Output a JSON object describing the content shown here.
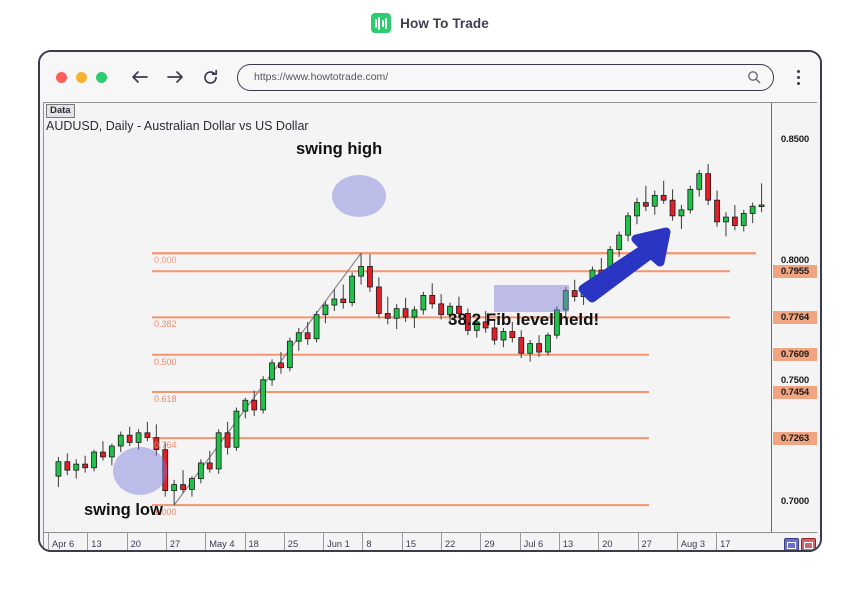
{
  "brand": {
    "title": "How To Trade",
    "icon": "bar-chart-icon",
    "color": "#2ecc71"
  },
  "browser": {
    "url": "https://www.howtotrade.com/",
    "back_icon": "back-arrow-icon",
    "forward_icon": "forward-arrow-icon",
    "reload_icon": "reload-icon",
    "search_icon": "search-icon",
    "menu_icon": "kebab-menu-icon",
    "lights": [
      "close-red",
      "minimize-yellow",
      "maximize-green"
    ]
  },
  "chart": {
    "data_tab": "Data",
    "title": "AUDUSD, Daily - Australian Dollar vs US Dollar",
    "annotations": [
      {
        "id": "swing-high",
        "text": "swing high"
      },
      {
        "id": "swing-low",
        "text": "swing low"
      },
      {
        "id": "fib-held",
        "text": "38.2 Fib level held!"
      }
    ],
    "fib_labels": [
      "0.382",
      "0.500",
      "0.618",
      "0.764",
      "1.000"
    ],
    "price_labels": [
      {
        "value": "0.8500",
        "highlight": false
      },
      {
        "value": "0.8000",
        "highlight": false
      },
      {
        "value": "0.7955",
        "highlight": true
      },
      {
        "value": "0.7764",
        "highlight": true
      },
      {
        "value": "0.7609",
        "highlight": true
      },
      {
        "value": "0.7500",
        "highlight": false
      },
      {
        "value": "0.7454",
        "highlight": true
      },
      {
        "value": "0.7263",
        "highlight": true
      },
      {
        "value": "0.7000",
        "highlight": false
      }
    ],
    "date_labels": [
      "Apr 6",
      "13",
      "20",
      "27",
      "May 4",
      "18",
      "25",
      "Jun 1",
      "8",
      "15",
      "22",
      "29",
      "Jul 6",
      "13",
      "20",
      "27",
      "Aug 3",
      "17"
    ],
    "corner_buttons": [
      "pane-toggle-blue",
      "pane-toggle-red"
    ]
  },
  "chart_data": {
    "type": "candlestick",
    "title": "AUDUSD, Daily - Australian Dollar vs US Dollar",
    "symbol": "AUDUSD",
    "timeframe": "Daily",
    "xlabel": "",
    "ylabel": "",
    "ylim": [
      0.689,
      0.862
    ],
    "grid": false,
    "legend": "none",
    "x_ticks": [
      "Apr 6",
      "13",
      "20",
      "27",
      "May 4",
      "18",
      "25",
      "Jun 1",
      "8",
      "15",
      "22",
      "29",
      "Jul 6",
      "13",
      "20",
      "27",
      "Aug 3",
      "17"
    ],
    "y_ticks": [
      0.7,
      0.75,
      0.8,
      0.85
    ],
    "highlighted_prices": [
      0.7955,
      0.7764,
      0.7609,
      0.7454,
      0.7263
    ],
    "fib_retracement": {
      "swing_low": 0.6985,
      "swing_high": 0.803,
      "levels": [
        {
          "ratio": "0.000",
          "price": 0.803
        },
        {
          "ratio": "0.382",
          "price": 0.7764
        },
        {
          "ratio": "0.500",
          "price": 0.7609
        },
        {
          "ratio": "0.618",
          "price": 0.7454
        },
        {
          "ratio": "0.764",
          "price": 0.7263
        },
        {
          "ratio": "1.000",
          "price": 0.6985
        }
      ]
    },
    "series": [
      {
        "name": "AUDUSD",
        "candles": [
          {
            "o": 0.7105,
            "h": 0.7185,
            "l": 0.706,
            "c": 0.7165,
            "dir": "up"
          },
          {
            "o": 0.7165,
            "h": 0.72,
            "l": 0.711,
            "c": 0.713,
            "dir": "down"
          },
          {
            "o": 0.713,
            "h": 0.7175,
            "l": 0.7095,
            "c": 0.7155,
            "dir": "up"
          },
          {
            "o": 0.7155,
            "h": 0.719,
            "l": 0.712,
            "c": 0.714,
            "dir": "down"
          },
          {
            "o": 0.714,
            "h": 0.7215,
            "l": 0.7125,
            "c": 0.7205,
            "dir": "up"
          },
          {
            "o": 0.7205,
            "h": 0.725,
            "l": 0.717,
            "c": 0.7185,
            "dir": "down"
          },
          {
            "o": 0.7185,
            "h": 0.724,
            "l": 0.715,
            "c": 0.723,
            "dir": "up"
          },
          {
            "o": 0.723,
            "h": 0.729,
            "l": 0.7205,
            "c": 0.7275,
            "dir": "up"
          },
          {
            "o": 0.7275,
            "h": 0.731,
            "l": 0.723,
            "c": 0.7245,
            "dir": "down"
          },
          {
            "o": 0.7245,
            "h": 0.73,
            "l": 0.7215,
            "c": 0.7285,
            "dir": "up"
          },
          {
            "o": 0.7285,
            "h": 0.733,
            "l": 0.725,
            "c": 0.7265,
            "dir": "down"
          },
          {
            "o": 0.7265,
            "h": 0.732,
            "l": 0.719,
            "c": 0.7215,
            "dir": "down"
          },
          {
            "o": 0.7215,
            "h": 0.7245,
            "l": 0.702,
            "c": 0.7045,
            "dir": "down"
          },
          {
            "o": 0.7045,
            "h": 0.709,
            "l": 0.6985,
            "c": 0.707,
            "dir": "up"
          },
          {
            "o": 0.707,
            "h": 0.713,
            "l": 0.7035,
            "c": 0.705,
            "dir": "down"
          },
          {
            "o": 0.705,
            "h": 0.7105,
            "l": 0.702,
            "c": 0.7095,
            "dir": "up"
          },
          {
            "o": 0.7095,
            "h": 0.7175,
            "l": 0.7075,
            "c": 0.716,
            "dir": "up"
          },
          {
            "o": 0.716,
            "h": 0.721,
            "l": 0.712,
            "c": 0.7135,
            "dir": "down"
          },
          {
            "o": 0.7135,
            "h": 0.73,
            "l": 0.7115,
            "c": 0.7285,
            "dir": "up"
          },
          {
            "o": 0.7285,
            "h": 0.733,
            "l": 0.7195,
            "c": 0.7225,
            "dir": "down"
          },
          {
            "o": 0.7225,
            "h": 0.739,
            "l": 0.721,
            "c": 0.7375,
            "dir": "up"
          },
          {
            "o": 0.7375,
            "h": 0.743,
            "l": 0.7345,
            "c": 0.742,
            "dir": "up"
          },
          {
            "o": 0.742,
            "h": 0.746,
            "l": 0.7355,
            "c": 0.738,
            "dir": "down"
          },
          {
            "o": 0.738,
            "h": 0.752,
            "l": 0.7365,
            "c": 0.7505,
            "dir": "up"
          },
          {
            "o": 0.7505,
            "h": 0.759,
            "l": 0.748,
            "c": 0.7575,
            "dir": "up"
          },
          {
            "o": 0.7575,
            "h": 0.762,
            "l": 0.753,
            "c": 0.7555,
            "dir": "down"
          },
          {
            "o": 0.7555,
            "h": 0.768,
            "l": 0.754,
            "c": 0.7665,
            "dir": "up"
          },
          {
            "o": 0.7665,
            "h": 0.772,
            "l": 0.7625,
            "c": 0.77,
            "dir": "up"
          },
          {
            "o": 0.77,
            "h": 0.7745,
            "l": 0.765,
            "c": 0.7675,
            "dir": "down"
          },
          {
            "o": 0.7675,
            "h": 0.779,
            "l": 0.766,
            "c": 0.7775,
            "dir": "up"
          },
          {
            "o": 0.7775,
            "h": 0.783,
            "l": 0.774,
            "c": 0.7815,
            "dir": "up"
          },
          {
            "o": 0.7815,
            "h": 0.788,
            "l": 0.779,
            "c": 0.784,
            "dir": "up"
          },
          {
            "o": 0.784,
            "h": 0.79,
            "l": 0.78,
            "c": 0.7825,
            "dir": "down"
          },
          {
            "o": 0.7825,
            "h": 0.795,
            "l": 0.781,
            "c": 0.7935,
            "dir": "up"
          },
          {
            "o": 0.7935,
            "h": 0.803,
            "l": 0.79,
            "c": 0.7975,
            "dir": "up"
          },
          {
            "o": 0.7975,
            "h": 0.8025,
            "l": 0.787,
            "c": 0.789,
            "dir": "down"
          },
          {
            "o": 0.789,
            "h": 0.793,
            "l": 0.776,
            "c": 0.778,
            "dir": "down"
          },
          {
            "o": 0.778,
            "h": 0.785,
            "l": 0.7735,
            "c": 0.776,
            "dir": "down"
          },
          {
            "o": 0.776,
            "h": 0.782,
            "l": 0.7715,
            "c": 0.78,
            "dir": "up"
          },
          {
            "o": 0.78,
            "h": 0.7845,
            "l": 0.7745,
            "c": 0.7765,
            "dir": "down"
          },
          {
            "o": 0.7765,
            "h": 0.781,
            "l": 0.772,
            "c": 0.7795,
            "dir": "up"
          },
          {
            "o": 0.7795,
            "h": 0.787,
            "l": 0.7775,
            "c": 0.7855,
            "dir": "up"
          },
          {
            "o": 0.7855,
            "h": 0.7905,
            "l": 0.78,
            "c": 0.782,
            "dir": "down"
          },
          {
            "o": 0.782,
            "h": 0.786,
            "l": 0.7755,
            "c": 0.7775,
            "dir": "down"
          },
          {
            "o": 0.7775,
            "h": 0.7825,
            "l": 0.774,
            "c": 0.781,
            "dir": "up"
          },
          {
            "o": 0.781,
            "h": 0.785,
            "l": 0.776,
            "c": 0.778,
            "dir": "down"
          },
          {
            "o": 0.778,
            "h": 0.78,
            "l": 0.769,
            "c": 0.771,
            "dir": "down"
          },
          {
            "o": 0.771,
            "h": 0.776,
            "l": 0.768,
            "c": 0.7745,
            "dir": "up"
          },
          {
            "o": 0.7745,
            "h": 0.779,
            "l": 0.77,
            "c": 0.772,
            "dir": "down"
          },
          {
            "o": 0.772,
            "h": 0.7755,
            "l": 0.765,
            "c": 0.767,
            "dir": "down"
          },
          {
            "o": 0.767,
            "h": 0.772,
            "l": 0.764,
            "c": 0.7705,
            "dir": "up"
          },
          {
            "o": 0.7705,
            "h": 0.7745,
            "l": 0.766,
            "c": 0.768,
            "dir": "down"
          },
          {
            "o": 0.768,
            "h": 0.771,
            "l": 0.7595,
            "c": 0.7615,
            "dir": "down"
          },
          {
            "o": 0.7615,
            "h": 0.767,
            "l": 0.758,
            "c": 0.7655,
            "dir": "up"
          },
          {
            "o": 0.7655,
            "h": 0.769,
            "l": 0.76,
            "c": 0.762,
            "dir": "down"
          },
          {
            "o": 0.762,
            "h": 0.77,
            "l": 0.7605,
            "c": 0.769,
            "dir": "up"
          },
          {
            "o": 0.769,
            "h": 0.781,
            "l": 0.7675,
            "c": 0.7795,
            "dir": "up"
          },
          {
            "o": 0.7795,
            "h": 0.789,
            "l": 0.777,
            "c": 0.7875,
            "dir": "up"
          },
          {
            "o": 0.7875,
            "h": 0.792,
            "l": 0.783,
            "c": 0.785,
            "dir": "down"
          },
          {
            "o": 0.785,
            "h": 0.79,
            "l": 0.7815,
            "c": 0.7885,
            "dir": "up"
          },
          {
            "o": 0.7885,
            "h": 0.7975,
            "l": 0.787,
            "c": 0.796,
            "dir": "up"
          },
          {
            "o": 0.796,
            "h": 0.801,
            "l": 0.792,
            "c": 0.794,
            "dir": "down"
          },
          {
            "o": 0.794,
            "h": 0.806,
            "l": 0.7925,
            "c": 0.8045,
            "dir": "up"
          },
          {
            "o": 0.8045,
            "h": 0.812,
            "l": 0.8015,
            "c": 0.8105,
            "dir": "up"
          },
          {
            "o": 0.8105,
            "h": 0.82,
            "l": 0.808,
            "c": 0.8185,
            "dir": "up"
          },
          {
            "o": 0.8185,
            "h": 0.826,
            "l": 0.815,
            "c": 0.824,
            "dir": "up"
          },
          {
            "o": 0.824,
            "h": 0.831,
            "l": 0.8205,
            "c": 0.8225,
            "dir": "down"
          },
          {
            "o": 0.8225,
            "h": 0.829,
            "l": 0.819,
            "c": 0.827,
            "dir": "up"
          },
          {
            "o": 0.827,
            "h": 0.833,
            "l": 0.8235,
            "c": 0.825,
            "dir": "down"
          },
          {
            "o": 0.825,
            "h": 0.8295,
            "l": 0.8165,
            "c": 0.8185,
            "dir": "down"
          },
          {
            "o": 0.8185,
            "h": 0.823,
            "l": 0.813,
            "c": 0.821,
            "dir": "up"
          },
          {
            "o": 0.821,
            "h": 0.831,
            "l": 0.8195,
            "c": 0.8295,
            "dir": "up"
          },
          {
            "o": 0.8295,
            "h": 0.8375,
            "l": 0.8265,
            "c": 0.836,
            "dir": "up"
          },
          {
            "o": 0.836,
            "h": 0.84,
            "l": 0.823,
            "c": 0.825,
            "dir": "down"
          },
          {
            "o": 0.825,
            "h": 0.829,
            "l": 0.814,
            "c": 0.816,
            "dir": "down"
          },
          {
            "o": 0.816,
            "h": 0.82,
            "l": 0.81,
            "c": 0.818,
            "dir": "up"
          },
          {
            "o": 0.818,
            "h": 0.823,
            "l": 0.8125,
            "c": 0.8145,
            "dir": "down"
          },
          {
            "o": 0.8145,
            "h": 0.821,
            "l": 0.812,
            "c": 0.8195,
            "dir": "up"
          },
          {
            "o": 0.8195,
            "h": 0.824,
            "l": 0.8155,
            "c": 0.8225,
            "dir": "up"
          },
          {
            "o": 0.8225,
            "h": 0.832,
            "l": 0.82,
            "c": 0.823,
            "dir": "up"
          }
        ]
      }
    ]
  }
}
